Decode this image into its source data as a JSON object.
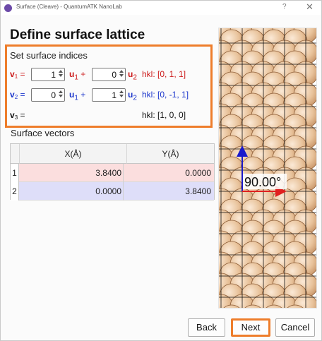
{
  "window": {
    "title": "Surface (Cleave) - QuantumATK NanoLab",
    "help_glyph": "?",
    "close_glyph": "✕"
  },
  "heading": "Define surface lattice",
  "indices": {
    "section_label": "Set surface indices",
    "v1": {
      "label": "v",
      "sub": "1",
      "eq": " =",
      "u1_value": "1",
      "u2_value": "0",
      "hkl": "hkl: [0, 1, 1]"
    },
    "v2": {
      "label": "v",
      "sub": "2",
      "eq": " =",
      "u1_value": "0",
      "u2_value": "1",
      "hkl": "hkl: [0, -1, 1]"
    },
    "v3": {
      "label": "v",
      "sub": "3",
      "eq": " =",
      "hkl": "hkl: [1, 0, 0]"
    },
    "u_label": "u",
    "u1_sub": "1",
    "u2_sub": "2",
    "plus": "+"
  },
  "surface_vectors": {
    "label": "Surface  vectors",
    "columns": [
      "X(Å)",
      "Y(Å)"
    ],
    "rows": [
      {
        "num": "1",
        "x": "3.8400",
        "y": "0.0000"
      },
      {
        "num": "2",
        "x": "0.0000",
        "y": "3.8400"
      }
    ]
  },
  "lattice_view": {
    "angle_label": "90.00°",
    "atom_color": "#e8c29a",
    "vector1_color": "#e02020",
    "vector2_color": "#1a1acc"
  },
  "buttons": {
    "back": "Back",
    "next": "Next",
    "cancel": "Cancel"
  },
  "colors": {
    "highlight": "#ee7d2b",
    "v1_text": "#cc1a1a",
    "v2_text": "#1a35cc",
    "row1_bg": "#fbdede",
    "row2_bg": "#dedef9"
  }
}
